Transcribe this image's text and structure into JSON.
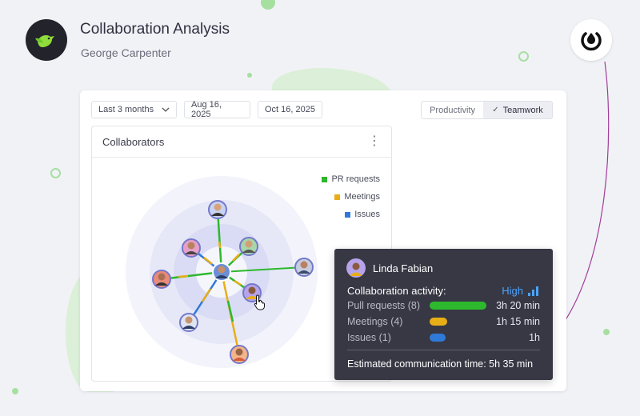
{
  "header": {
    "title": "Collaboration Analysis",
    "subtitle": "George Carpenter"
  },
  "icons": {
    "app_logo": "bird-icon",
    "corner_logo": "drop-ring-icon"
  },
  "colors": {
    "pr": "#2db82d",
    "meetings": "#e8ae16",
    "issues": "#2f7ad8",
    "accent": "#4ba3ff",
    "tooltip_bg": "#373844"
  },
  "filters": {
    "range": "Last 3 months",
    "start": "Aug 16, 2025",
    "end": "Oct 16, 2025"
  },
  "view_toggle": {
    "productivity": "Productivity",
    "teamwork": "Teamwork",
    "selected": "Teamwork"
  },
  "panel": {
    "title": "Collaborators",
    "legend": [
      {
        "label": "PR requests",
        "color": "#2db82d"
      },
      {
        "label": "Meetings",
        "color": "#e8ae16"
      },
      {
        "label": "Issues",
        "color": "#2f7ad8"
      }
    ]
  },
  "tooltip": {
    "name": "Linda Fabian",
    "heading": "Collaboration activity:",
    "level": "High",
    "rows": [
      {
        "label": "Pull requests (8)",
        "value": "3h 20 min",
        "color": "#2db82d",
        "fraction": 1.0
      },
      {
        "label": "Meetings (4)",
        "value": "1h 15 min",
        "color": "#e8ae16",
        "fraction": 0.31
      },
      {
        "label": "Issues (1)",
        "value": "1h",
        "color": "#2f7ad8",
        "fraction": 0.28
      }
    ],
    "total": "Estimated communication time: 5h 35 min"
  }
}
